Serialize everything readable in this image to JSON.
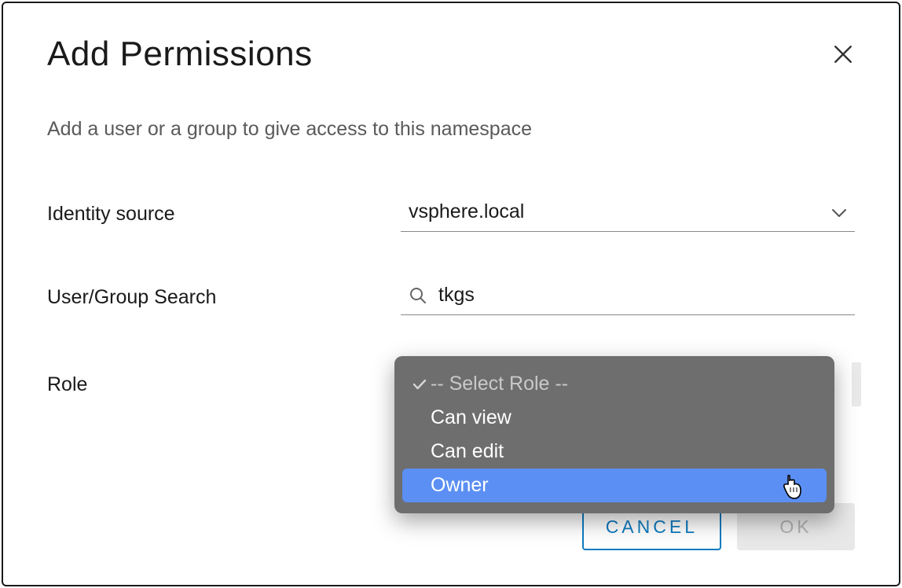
{
  "dialog": {
    "title": "Add Permissions",
    "subtitle": "Add a user or a group to give access to this namespace"
  },
  "form": {
    "identity_source": {
      "label": "Identity source",
      "value": "vsphere.local"
    },
    "user_search": {
      "label": "User/Group Search",
      "value": "tkgs"
    },
    "role": {
      "label": "Role",
      "placeholder": "-- Select Role --",
      "options": [
        "Can view",
        "Can edit",
        "Owner"
      ],
      "highlighted_index": 2
    }
  },
  "footer": {
    "cancel": "CANCEL",
    "ok": "OK"
  }
}
